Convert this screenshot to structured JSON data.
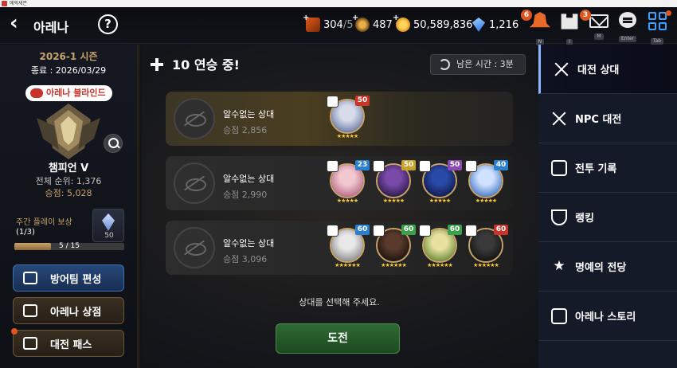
{
  "window": {
    "title": "에픽세븐"
  },
  "header": {
    "title": "아레나",
    "help_glyph": "?",
    "resources": [
      {
        "icon": "crossed-swords-icon",
        "value": "304",
        "sub": "/5"
      },
      {
        "icon": "laurel-icon",
        "value": "487",
        "sub": ""
      },
      {
        "icon": "gold-coin-icon",
        "value": "50,589,836",
        "sub": ""
      },
      {
        "icon": "crystal-icon",
        "value": "1,216",
        "sub": ""
      }
    ],
    "buttons": [
      {
        "name": "notification",
        "key": "N",
        "badge": "6"
      },
      {
        "name": "team",
        "key": "I",
        "badge": ""
      },
      {
        "name": "mail",
        "key": "M",
        "badge": "3"
      },
      {
        "name": "chat",
        "key": "Enter",
        "badge": ""
      },
      {
        "name": "menu",
        "key": "Tab",
        "badge": ""
      }
    ]
  },
  "profile": {
    "season": "2026-1 시즌",
    "end": "종료 : 2026/03/29",
    "tag": "아레나 블라인드",
    "rank_name": "챔피언 V",
    "rank_global": "전체 순위: 1,376",
    "score": "승점: 5,028",
    "weekly_label": "주간 플레이 보상",
    "weekly_count": "(1/3)",
    "reward_count": "50",
    "progress_text": "5 / 15",
    "progress_value": 0.33
  },
  "left_buttons": [
    {
      "label": "방어팀 편성",
      "icon": "shield-icon",
      "style": "blue",
      "dot": false
    },
    {
      "label": "아레나 상점",
      "icon": "scales-icon",
      "style": "brown",
      "dot": false
    },
    {
      "label": "대전 패스",
      "icon": "ticket-icon",
      "style": "brown",
      "dot": true
    }
  ],
  "center": {
    "streak": "10 연승 중!",
    "time_left": "남은 시간 : 3분",
    "prompt": "상대를 선택해 주세요.",
    "challenge": "도전",
    "opponents": [
      {
        "name": "알수없는 상대",
        "score": "승점 2,856",
        "heroes": [
          {
            "level": "50",
            "lvl_color": "#c8332a",
            "face": [
              "#d8dcea",
              "#6a7aa8"
            ],
            "stars": "★★★★★"
          }
        ]
      },
      {
        "name": "알수없는 상대",
        "score": "승점 2,990",
        "heroes": [
          {
            "level": "23",
            "lvl_color": "#2a7fd0",
            "face": [
              "#f2c8d0",
              "#b86a8a"
            ],
            "stars": "★★★★★"
          },
          {
            "level": "50",
            "lvl_color": "#c8a02a",
            "face": [
              "#7a4aa8",
              "#2a1a48"
            ],
            "stars": "★★★★★"
          },
          {
            "level": "50",
            "lvl_color": "#8a4ab0",
            "face": [
              "#2a4aa8",
              "#0e1a48"
            ],
            "stars": "★★★★★"
          },
          {
            "level": "40",
            "lvl_color": "#2a7fd0",
            "face": [
              "#cfe2ff",
              "#4a7ac8"
            ],
            "stars": "★★★★★"
          }
        ]
      },
      {
        "name": "알수없는 상대",
        "score": "승점 3,096",
        "heroes": [
          {
            "level": "60",
            "lvl_color": "#2a7fd0",
            "face": [
              "#e8e8e8",
              "#8a8a8a"
            ],
            "stars": "★★★★★★"
          },
          {
            "level": "60",
            "lvl_color": "#3aa04a",
            "face": [
              "#5a3a2a",
              "#1a120e"
            ],
            "stars": "★★★★★★"
          },
          {
            "level": "60",
            "lvl_color": "#3aa04a",
            "face": [
              "#e8e0a0",
              "#6a8a3a"
            ],
            "stars": "★★★★★★"
          },
          {
            "level": "60",
            "lvl_color": "#c8332a",
            "face": [
              "#3a3a3a",
              "#111111"
            ],
            "stars": "★★★★★★"
          }
        ]
      }
    ]
  },
  "right_menu": [
    {
      "label": "대전 상대",
      "icon": "crossed-swords-icon",
      "active": true
    },
    {
      "label": "NPC 대전",
      "icon": "npc-swords-icon",
      "active": false
    },
    {
      "label": "전투 기록",
      "icon": "clipboard-icon",
      "active": false
    },
    {
      "label": "랭킹",
      "icon": "trophy-icon",
      "active": false
    },
    {
      "label": "명예의 전당",
      "icon": "laurel-star-icon",
      "active": false
    },
    {
      "label": "아레나 스토리",
      "icon": "book-icon",
      "active": false
    }
  ]
}
